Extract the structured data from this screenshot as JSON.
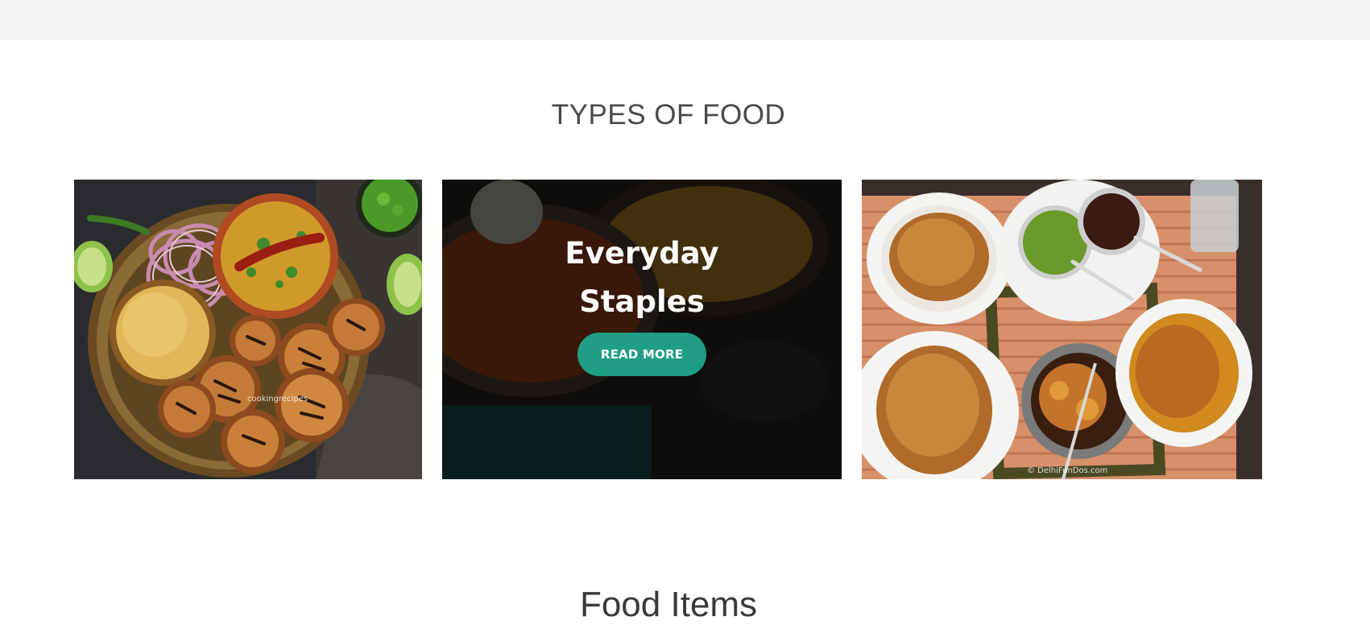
{
  "section": {
    "title": "TYPES OF FOOD"
  },
  "cards": [
    {
      "image_alt": "Litti chokha platter with dal, onions, chillies and lime",
      "watermark": "cookingrecipes"
    },
    {
      "caption_line1": "Everyday",
      "caption_line2": "Staples",
      "button_label": "READ MORE"
    },
    {
      "image_alt": "Kachori with chutneys and aloo sabzi",
      "watermark": "© DelhiFunDos.com"
    }
  ],
  "next_section": {
    "title": "Food Items"
  },
  "colors": {
    "accent": "#1f9e85",
    "title_text": "#4a4a4a",
    "top_band": "#f4f4f6"
  }
}
